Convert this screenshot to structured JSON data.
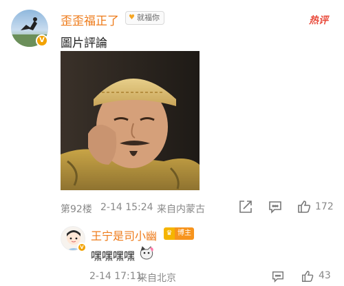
{
  "comment": {
    "username": "歪歪福正了",
    "fan_tag": "就福你",
    "hot_label": "热评",
    "text": "圖片評論",
    "floor": "第92楼",
    "date": "2-14 15:24",
    "source": "来自内蒙古",
    "like_count": "172"
  },
  "reply": {
    "username": "王宁是司小幽",
    "badge_label": "博主",
    "text": "嘿嘿嘿嘿",
    "date": "2-14 17:11",
    "source": "来自北京",
    "like_count": "43"
  },
  "colors": {
    "username": "#ee7a18",
    "hot": "#e94b3c",
    "meta": "#888888",
    "verified_badge": "#f2a200"
  },
  "icons": [
    "verified-badge-icon",
    "fan-tag-icon",
    "share-icon",
    "comment-icon",
    "like-icon",
    "crown-icon",
    "cat-emoji-icon"
  ]
}
